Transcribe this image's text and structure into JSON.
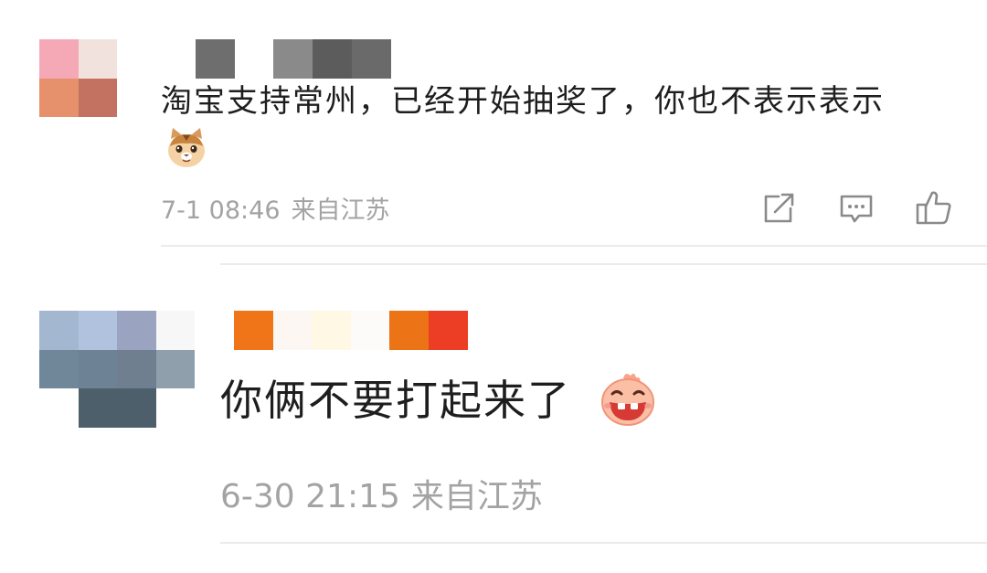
{
  "comments": [
    {
      "text": "淘宝支持常州，已经开始抽奖了，你也不表示表示",
      "emoji": "cat-face-emoji",
      "time": "7-1 08:46",
      "location": "来自江苏",
      "avatar_pixels": [
        "#f5a9b7",
        "#f2e2dd",
        "#e6906c",
        "#c37261"
      ],
      "name_pixels": [
        "#6e6e6e",
        "#ffffff",
        "#8a8a8a",
        "#5c5c5c",
        "#6a6a6a"
      ],
      "actions": [
        {
          "icon": "share-icon"
        },
        {
          "icon": "comment-icon"
        },
        {
          "icon": "thumbs-up-icon"
        }
      ]
    },
    {
      "text": "你俩不要打起来了",
      "emoji": "grinning-face-emoji",
      "time": "6-30 21:15",
      "location": "来自江苏",
      "avatar_pixels": [
        "#a3b8d0",
        "#b1c2de",
        "#9aa3bf",
        "#f7f7f7",
        "#6f8799",
        "#6d8294",
        "#6f7f8f",
        "#8f9fab",
        "#ffffff",
        "#4d5f6b",
        "#4d5f6b",
        "#ffffff"
      ],
      "name_pixels": [
        "#f07418",
        "#fdf7f3",
        "#fff8e4",
        "#fdfbfa",
        "#ec7316",
        "#ec3e24"
      ]
    }
  ],
  "colors": {
    "text": "#1e1e1e",
    "meta": "#a3a3a3",
    "divider": "#ebebeb",
    "icon": "#8a8a8a"
  }
}
